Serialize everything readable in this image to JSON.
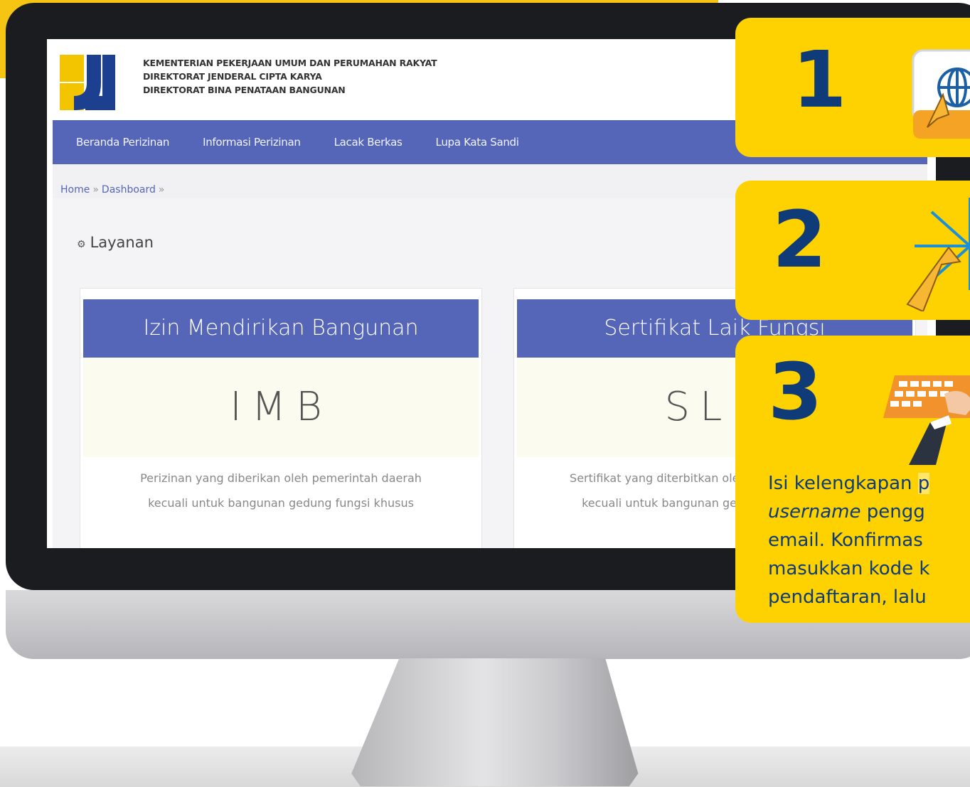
{
  "header": {
    "org_line1": "KEMENTERIAN PEKERJAAN UMUM DAN PERUMAHAN RAKYAT",
    "org_line2": "DIREKTORAT JENDERAL CIPTA KARYA",
    "org_line3": "DIREKTORAT BINA PENATAAN BANGUNAN"
  },
  "nav": {
    "items": [
      {
        "label": "Beranda Perizinan"
      },
      {
        "label": "Informasi Perizinan"
      },
      {
        "label": "Lacak Berkas"
      },
      {
        "label": "Lupa Kata Sandi"
      }
    ]
  },
  "breadcrumb": {
    "home": "Home",
    "dashboard": "Dashboard",
    "separator": "»"
  },
  "section": {
    "title": "Layanan",
    "icon": "gears-icon"
  },
  "cards": [
    {
      "title": "Izin Mendirikan Bangunan",
      "code": "IMB",
      "desc_line1": "Perizinan yang diberikan oleh pemerintah daerah",
      "desc_line2": "kecuali untuk bangunan gedung fungsi khusus"
    },
    {
      "title": "Sertifikat Laik Fungsi",
      "code": "SLF",
      "desc_line1": "Sertifikat yang diterbitkan oleh pemerintah daerah",
      "desc_line2": "kecuali untuk bangunan gedung fungsi khusus"
    }
  ],
  "steps": [
    {
      "number": "1",
      "icon": "globe-cursor-icon"
    },
    {
      "number": "2",
      "icon": "click-burst-cursor-icon"
    },
    {
      "number": "3",
      "icon": "typing-keyboard-icon",
      "text_line1_a": "Isi kelengkapan ",
      "text_line1_b": "p",
      "text_line2_em": "username",
      "text_line2_rest": " pengg",
      "text_line3": "email. Konfirmas",
      "text_line4": "masukkan kode k",
      "text_line5": "pendaftaran, lalu"
    }
  ],
  "colors": {
    "brand_yellow": "#fdd200",
    "nav_blue": "#5566b8",
    "step_navy": "#0f3b79"
  }
}
